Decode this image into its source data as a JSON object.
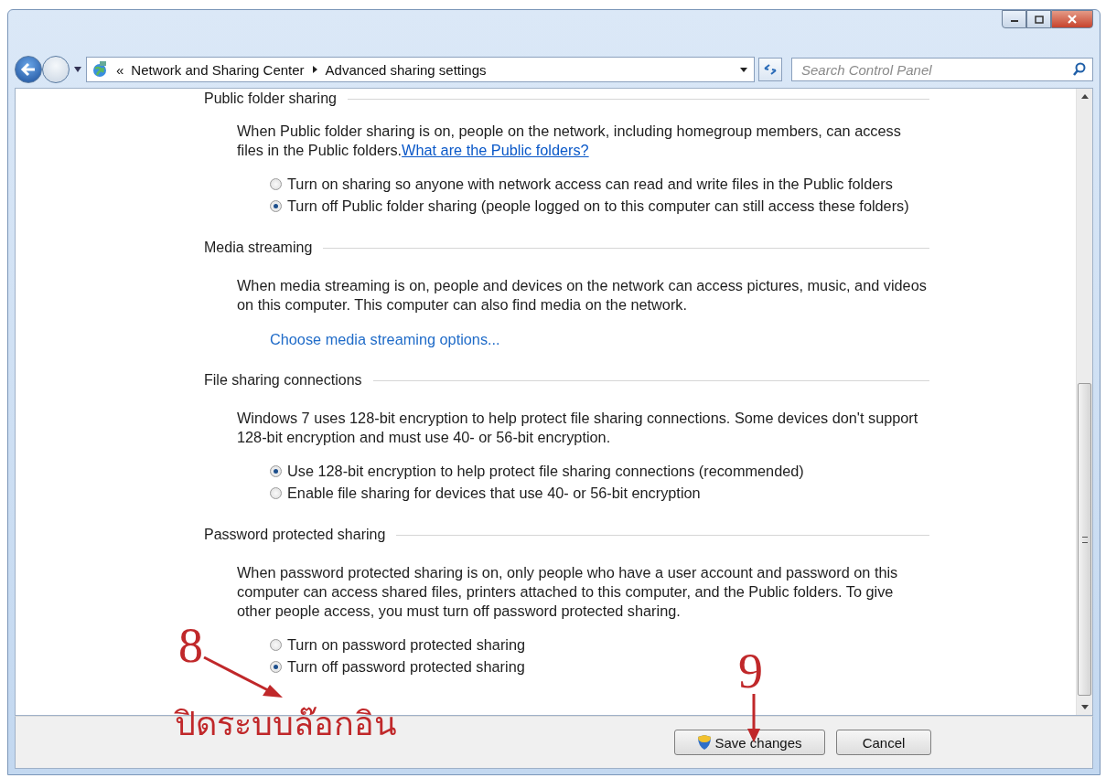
{
  "address_bar": {
    "overflow": "«",
    "breadcrumbs": [
      "Network and Sharing Center",
      "Advanced sharing settings"
    ]
  },
  "search": {
    "placeholder": "Search Control Panel"
  },
  "sections": [
    {
      "title": "Public folder sharing",
      "description": {
        "text": "When Public folder sharing is on, people on the network, including homegroup members, can access files in the Public folders.",
        "link": "What are the Public folders?"
      },
      "options": [
        {
          "label": "Turn on sharing so anyone with network access can read and write files in the Public folders",
          "selected": false
        },
        {
          "label": "Turn off Public folder sharing (people logged on to this computer can still access these folders)",
          "selected": true
        }
      ]
    },
    {
      "title": "Media streaming",
      "description": {
        "text": "When media streaming is on, people and devices on the network can access pictures, music, and videos on this computer. This computer can also find media on the network."
      },
      "action_link": "Choose media streaming options..."
    },
    {
      "title": "File sharing connections",
      "description": {
        "text": "Windows 7 uses 128-bit encryption to help protect file sharing connections. Some devices don't support 128-bit encryption and must use 40- or 56-bit encryption."
      },
      "options": [
        {
          "label": "Use 128-bit encryption to help protect file sharing connections (recommended)",
          "selected": true
        },
        {
          "label": "Enable file sharing for devices that use 40- or 56-bit encryption",
          "selected": false
        }
      ]
    },
    {
      "title": "Password protected sharing",
      "description": {
        "text": "When password protected sharing is on, only people who have a user account and password on this computer can access shared files, printers attached to this computer, and the Public folders. To give other people access, you must turn off password protected sharing."
      },
      "options": [
        {
          "label": "Turn on password protected sharing",
          "selected": false
        },
        {
          "label": "Turn off password protected sharing",
          "selected": true
        }
      ]
    }
  ],
  "buttons": [
    {
      "label": "Save changes",
      "kind": "shield"
    },
    {
      "label": "Cancel",
      "kind": "plain"
    }
  ],
  "annotations": [
    {
      "label": "8",
      "kind": "step"
    },
    {
      "label": "9",
      "kind": "step"
    },
    {
      "label": "ปิดระบบล๊อกอิน",
      "kind": "note"
    }
  ]
}
